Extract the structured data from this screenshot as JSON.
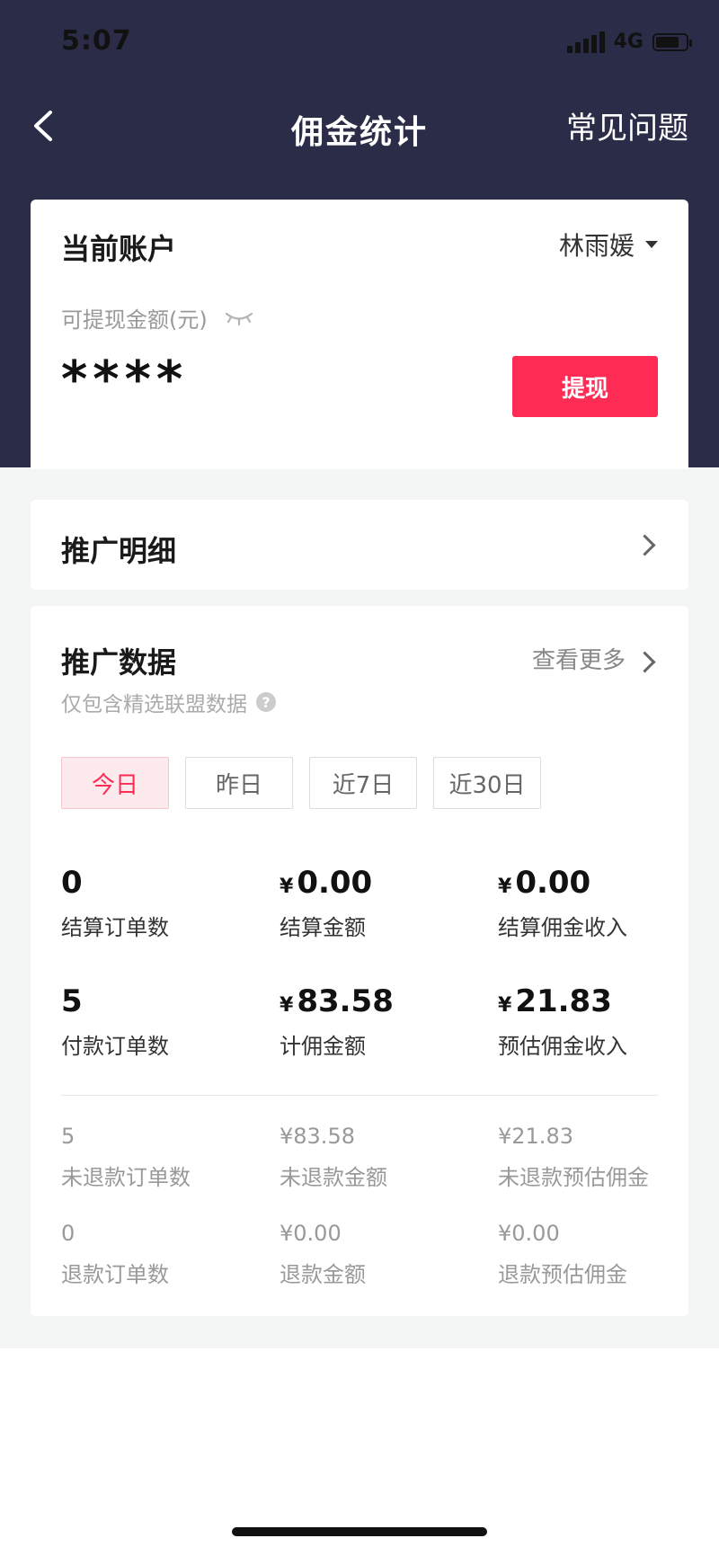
{
  "status_bar": {
    "time": "5:07",
    "network": "4G"
  },
  "nav": {
    "title": "佣金统计",
    "faq": "常见问题"
  },
  "account": {
    "title": "当前账户",
    "user": "林雨媛",
    "balance_label": "可提现金额(元)",
    "balance_masked": "****",
    "withdraw": "提现"
  },
  "detail": {
    "title": "推广明细"
  },
  "data": {
    "title": "推广数据",
    "more": "查看更多",
    "subtitle": "仅包含精选联盟数据",
    "help": "?",
    "tabs": [
      "今日",
      "昨日",
      "近7日",
      "近30日"
    ],
    "stats": {
      "settled_orders": {
        "value": "0",
        "label": "结算订单数"
      },
      "settled_amount": {
        "currency": "¥",
        "value": "0.00",
        "label": "结算金额"
      },
      "settled_commission": {
        "currency": "¥",
        "value": "0.00",
        "label": "结算佣金收入"
      },
      "paid_orders": {
        "value": "5",
        "label": "付款订单数"
      },
      "commissionable_amount": {
        "currency": "¥",
        "value": "83.58",
        "label": "计佣金额"
      },
      "estimated_commission": {
        "currency": "¥",
        "value": "21.83",
        "label": "预估佣金收入"
      }
    },
    "refund_stats": {
      "non_refund_orders": {
        "value": "5",
        "label": "未退款订单数"
      },
      "non_refund_amount": {
        "value": "¥83.58",
        "label": "未退款金额"
      },
      "non_refund_commission": {
        "value": "¥21.83",
        "label": "未退款预估佣金"
      },
      "refund_orders": {
        "value": "0",
        "label": "退款订单数"
      },
      "refund_amount": {
        "value": "¥0.00",
        "label": "退款金额"
      },
      "refund_commission": {
        "value": "¥0.00",
        "label": "退款预估佣金"
      }
    }
  },
  "colors": {
    "header": "#2b2d48",
    "accent": "#fe2c55",
    "page_bg": "#f4f5f5"
  }
}
